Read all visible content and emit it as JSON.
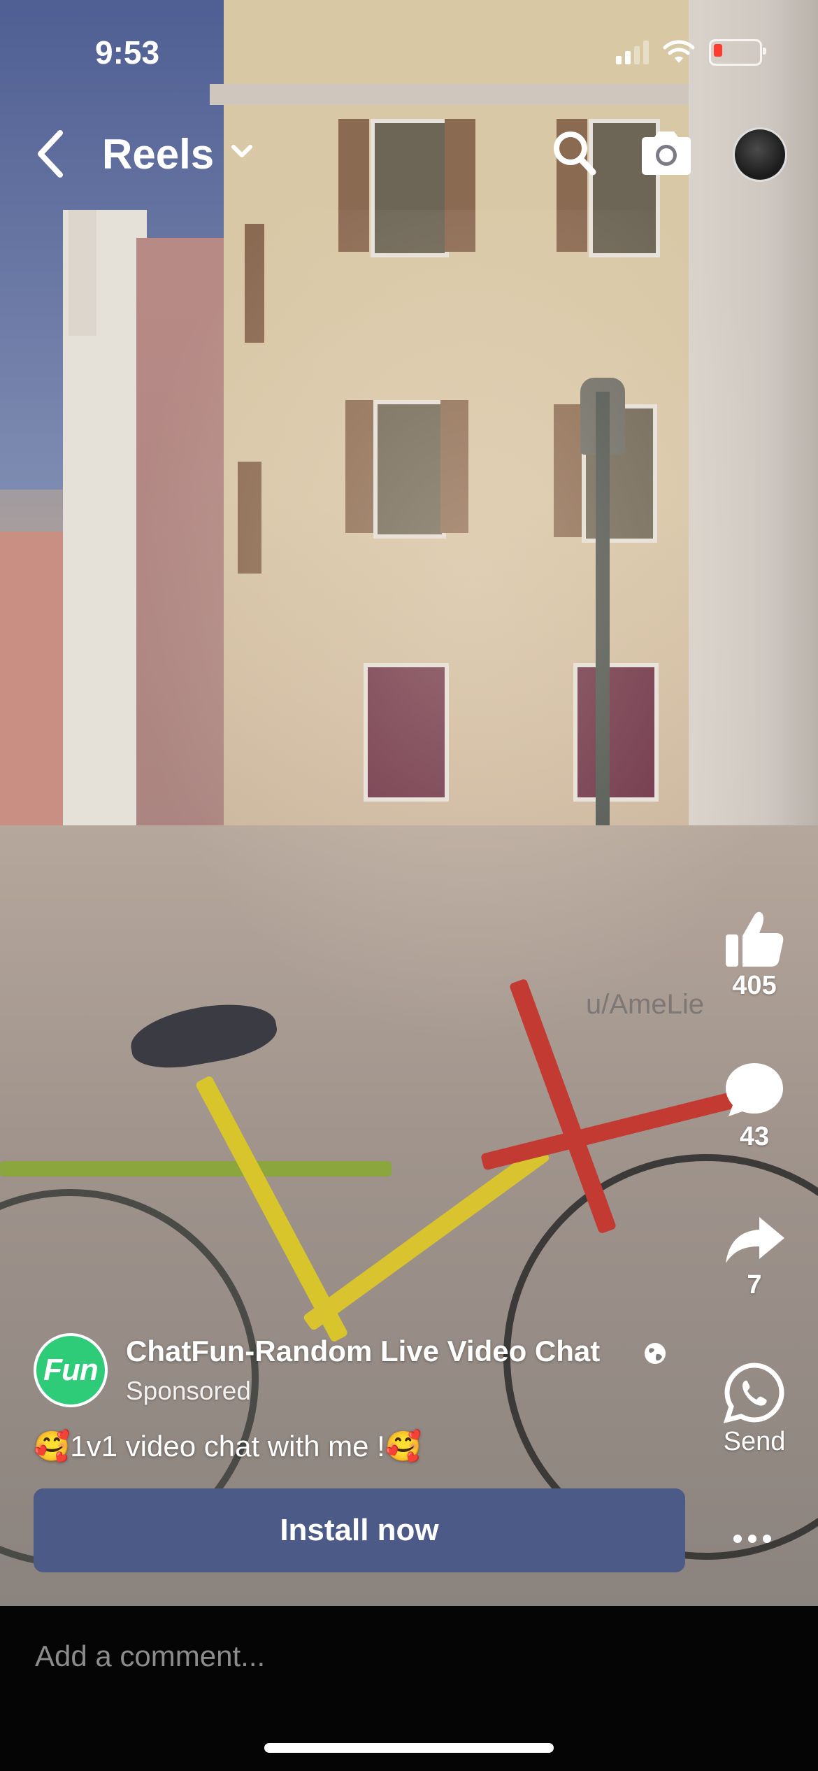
{
  "status_bar": {
    "time": "9:53",
    "icons": [
      "signal-icon",
      "wifi-icon",
      "battery-low-icon"
    ]
  },
  "topbar": {
    "title": "Reels",
    "icons": [
      "back-chevron-icon",
      "chevron-down-icon",
      "search-icon",
      "camera-icon",
      "profile-avatar"
    ]
  },
  "video": {
    "watermark": "u/AmeLie"
  },
  "actions": {
    "like": {
      "icon": "thumbs-up-icon",
      "count": "405"
    },
    "comment": {
      "icon": "comment-bubble-icon",
      "count": "43"
    },
    "share": {
      "icon": "share-arrow-icon",
      "count": "7"
    },
    "send": {
      "icon": "whatsapp-icon",
      "label": "Send"
    },
    "more": {
      "icon": "more-dots-icon"
    }
  },
  "ad": {
    "logo_text": "Fun",
    "advertiser": "ChatFun-Random Live Video Chat",
    "audience_icon": "globe-icon",
    "sponsored_label": "Sponsored",
    "caption": "🥰1v1 video chat with me !🥰",
    "cta_label": "Install now"
  },
  "comment_bar": {
    "placeholder": "Add a comment..."
  },
  "colors": {
    "cta_background": "#4b5a86",
    "logo_green": "#2ecb79",
    "comment_bar_bg": "#050505"
  }
}
